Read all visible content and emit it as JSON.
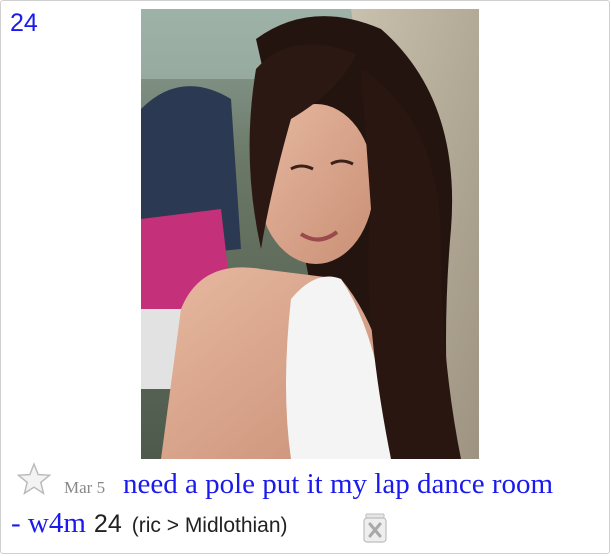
{
  "listing": {
    "image_price": "24",
    "star_icon": "star-outline-icon",
    "date": "Mar 5",
    "title_line1": "need a pole put it my lap dance room",
    "title_line2": "- w4m",
    "price": "24",
    "hood": "(ric > Midlothian)",
    "hide_icon": "trash-x-icon"
  },
  "colors": {
    "link": "#1a1aee",
    "date": "#888888",
    "text": "#222222",
    "border": "#d0d0d0"
  }
}
